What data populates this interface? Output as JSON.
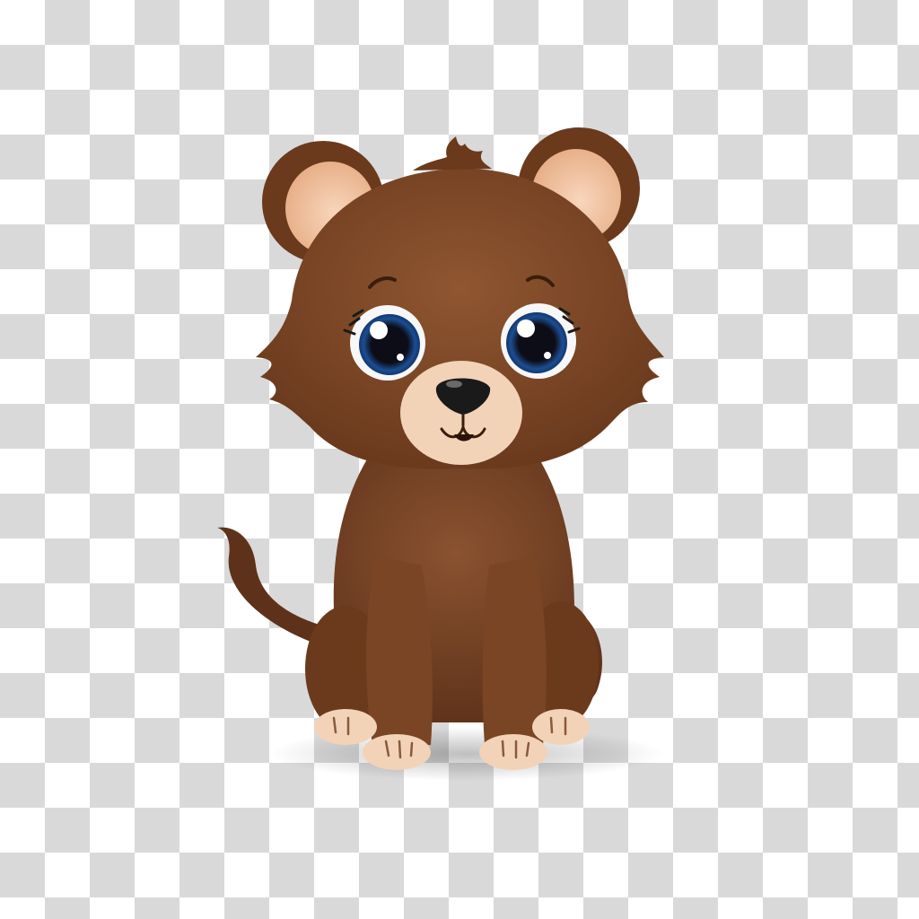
{
  "image": {
    "subject": "cartoon-brown-bear-cub",
    "background": "transparency-checkerboard"
  },
  "colors": {
    "fur": "#7a4524",
    "fur_dark": "#5a2f17",
    "fur_light": "#8f5631",
    "muzzle": "#f2d3b8",
    "inner_ear": "#f5c9a8",
    "eye_iris": "#1c4e92",
    "nose": "#1a1a1a",
    "checker_dark": "#d9d9d9",
    "checker_light": "#ffffff"
  }
}
